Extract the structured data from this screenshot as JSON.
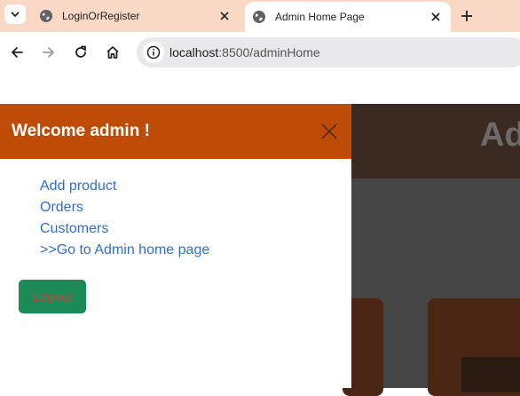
{
  "browser": {
    "tabs": [
      {
        "title": "LoginOrRegister",
        "active": false
      },
      {
        "title": "Admin Home Page",
        "active": true
      }
    ],
    "url_host": "localhost",
    "url_path": ":8500/adminHome",
    "icons": {
      "tab_search": "chevron-down-icon",
      "favicon": "globe-icon",
      "close": "close-icon",
      "new_tab": "plus-icon",
      "back": "arrow-left-icon",
      "forward": "arrow-right-icon",
      "reload": "reload-icon",
      "home": "home-icon",
      "site_info": "info-icon"
    }
  },
  "page": {
    "background_header_text": "Ad",
    "sidebar": {
      "title": "Welcome admin !",
      "links": [
        {
          "label": "Add product"
        },
        {
          "label": "Orders"
        },
        {
          "label": "Customers"
        },
        {
          "label": ">>Go to Admin home page"
        }
      ],
      "logout_label": "Logout"
    }
  },
  "colors": {
    "tabbar_bg": "#f9d9c6",
    "sidebar_header_bg": "#bf4c06",
    "link_color": "#2f6fc9",
    "logout_bg": "#1b8a57",
    "logout_text": "#c0443b",
    "overlay_dark": "#464646"
  }
}
